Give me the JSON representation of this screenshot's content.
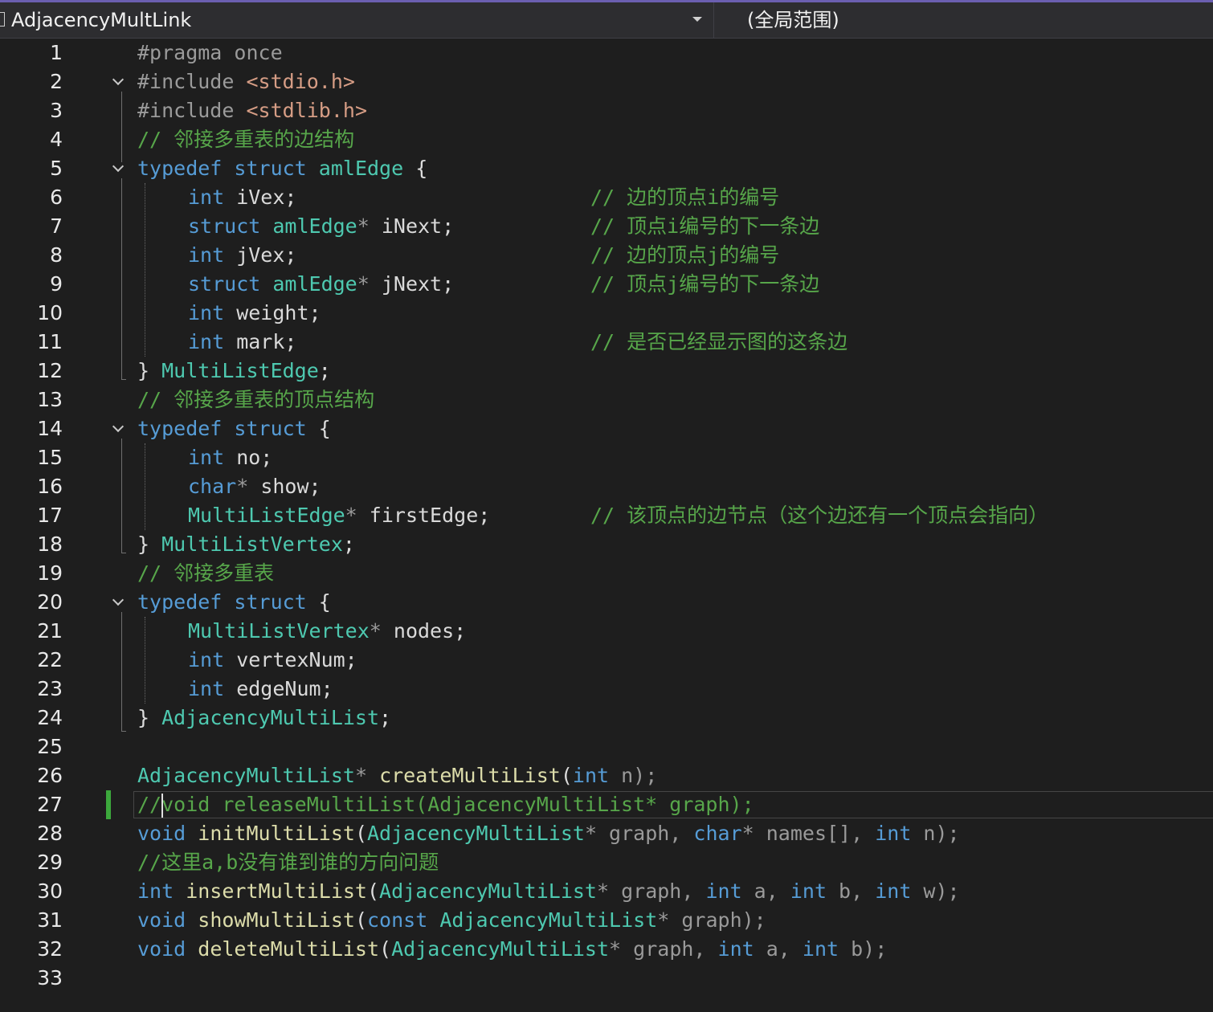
{
  "navbar": {
    "file_label": "AdjacencyMultLink",
    "scope_label": "(全局范围)"
  },
  "editor": {
    "lines": [
      {
        "n": "1"
      },
      {
        "n": "2"
      },
      {
        "n": "3"
      },
      {
        "n": "4"
      },
      {
        "n": "5"
      },
      {
        "n": "6"
      },
      {
        "n": "7"
      },
      {
        "n": "8"
      },
      {
        "n": "9"
      },
      {
        "n": "10"
      },
      {
        "n": "11"
      },
      {
        "n": "12"
      },
      {
        "n": "13"
      },
      {
        "n": "14"
      },
      {
        "n": "15"
      },
      {
        "n": "16"
      },
      {
        "n": "17"
      },
      {
        "n": "18"
      },
      {
        "n": "19"
      },
      {
        "n": "20"
      },
      {
        "n": "21"
      },
      {
        "n": "22"
      },
      {
        "n": "23"
      },
      {
        "n": "24"
      },
      {
        "n": "25"
      },
      {
        "n": "26"
      },
      {
        "n": "27"
      },
      {
        "n": "28"
      },
      {
        "n": "29"
      },
      {
        "n": "30"
      },
      {
        "n": "31"
      },
      {
        "n": "32"
      },
      {
        "n": "33"
      }
    ],
    "code": {
      "l1": {
        "pp": "#pragma",
        "rest": " once"
      },
      "l2": {
        "pp": "#include",
        "sp": " ",
        "hdr": "<stdio.h>"
      },
      "l3": {
        "pp": "#include",
        "sp": " ",
        "hdr": "<stdlib.h>"
      },
      "l4": {
        "comment": "// 邻接多重表的边结构"
      },
      "l5": {
        "kw1": "typedef",
        "kw2": "struct",
        "ty": "amlEdge",
        "tail": " {"
      },
      "l6": {
        "kw": "int",
        "id": " iVex;",
        "comment": "// 边的顶点i的编号"
      },
      "l7": {
        "kw": "struct",
        "ty": "amlEdge",
        "pr": "*",
        "id": " iNext;",
        "comment": "// 顶点i编号的下一条边"
      },
      "l8": {
        "kw": "int",
        "id": " jVex;",
        "comment": "// 边的顶点j的编号"
      },
      "l9": {
        "kw": "struct",
        "ty": "amlEdge",
        "pr": "*",
        "id": " jNext;",
        "comment": "// 顶点j编号的下一条边"
      },
      "l10": {
        "kw": "int",
        "id": " weight;"
      },
      "l11": {
        "kw": "int",
        "id": " mark;",
        "comment": "// 是否已经显示图的这条边"
      },
      "l12": {
        "brace": "} ",
        "ty": "MultiListEdge",
        "tail": ";"
      },
      "l13": {
        "comment": "// 邻接多重表的顶点结构"
      },
      "l14": {
        "kw1": "typedef",
        "kw2": "struct",
        "tail": " {"
      },
      "l15": {
        "kw": "int",
        "id": " no;"
      },
      "l16": {
        "kw": "char",
        "pr": "*",
        "id": " show;"
      },
      "l17": {
        "ty": "MultiListEdge",
        "pr": "*",
        "id": " firstEdge;",
        "comment": "// 该顶点的边节点（这个边还有一个顶点会指向）"
      },
      "l18": {
        "brace": "} ",
        "ty": "MultiListVertex",
        "tail": ";"
      },
      "l19": {
        "comment": "// 邻接多重表"
      },
      "l20": {
        "kw1": "typedef",
        "kw2": "struct",
        "tail": " {"
      },
      "l21": {
        "ty": "MultiListVertex",
        "pr": "*",
        "id": " nodes;"
      },
      "l22": {
        "kw": "int",
        "id": " vertexNum;"
      },
      "l23": {
        "kw": "int",
        "id": " edgeNum;"
      },
      "l24": {
        "brace": "} ",
        "ty": "AdjacencyMultiList",
        "tail": ";"
      },
      "l26": {
        "ty": "AdjacencyMultiList",
        "pr": "*",
        "sp": " ",
        "fn": "createMultiList",
        "p1": "(",
        "kw": "int",
        "p2": " n);"
      },
      "l27": {
        "c1": "//",
        "c2": "void releaseMultiList(AdjacencyMultiList* graph);"
      },
      "l28": {
        "kw1": "void",
        "fn": " initMultiList",
        "p1": "(",
        "ty": "AdjacencyMultiList",
        "pr1": "*",
        "a1": " graph, ",
        "kw2": "char",
        "pr2": "*",
        "a2": " names[], ",
        "kw3": "int",
        "a3": " n);"
      },
      "l29": {
        "comment": "//这里a,b没有谁到谁的方向问题"
      },
      "l30": {
        "kw1": "int",
        "fn": " insertMultiList",
        "p1": "(",
        "ty": "AdjacencyMultiList",
        "pr": "*",
        "a1": " graph, ",
        "kw2": "int",
        "a2": " a, ",
        "kw3": "int",
        "a3": " b, ",
        "kw4": "int",
        "a4": " w);"
      },
      "l31": {
        "kw1": "void",
        "fn": " showMultiList",
        "p1": "(",
        "kw2": "const",
        "sp": " ",
        "ty": "AdjacencyMultiList",
        "pr": "*",
        "a1": " graph);"
      },
      "l32": {
        "kw1": "void",
        "fn": " deleteMultiList",
        "p1": "(",
        "ty": "AdjacencyMultiList",
        "pr": "*",
        "a1": " graph, ",
        "kw2": "int",
        "a2": " a, ",
        "kw3": "int",
        "a3": " b);"
      }
    }
  },
  "colors": {
    "keyword": "#569cd6",
    "type": "#4ec9b0",
    "comment": "#57a64a",
    "preprocessor": "#9b9b9b",
    "string": "#d69d85",
    "function": "#dcdcaa",
    "identifier": "#dadada",
    "background": "#1e1e1e"
  }
}
